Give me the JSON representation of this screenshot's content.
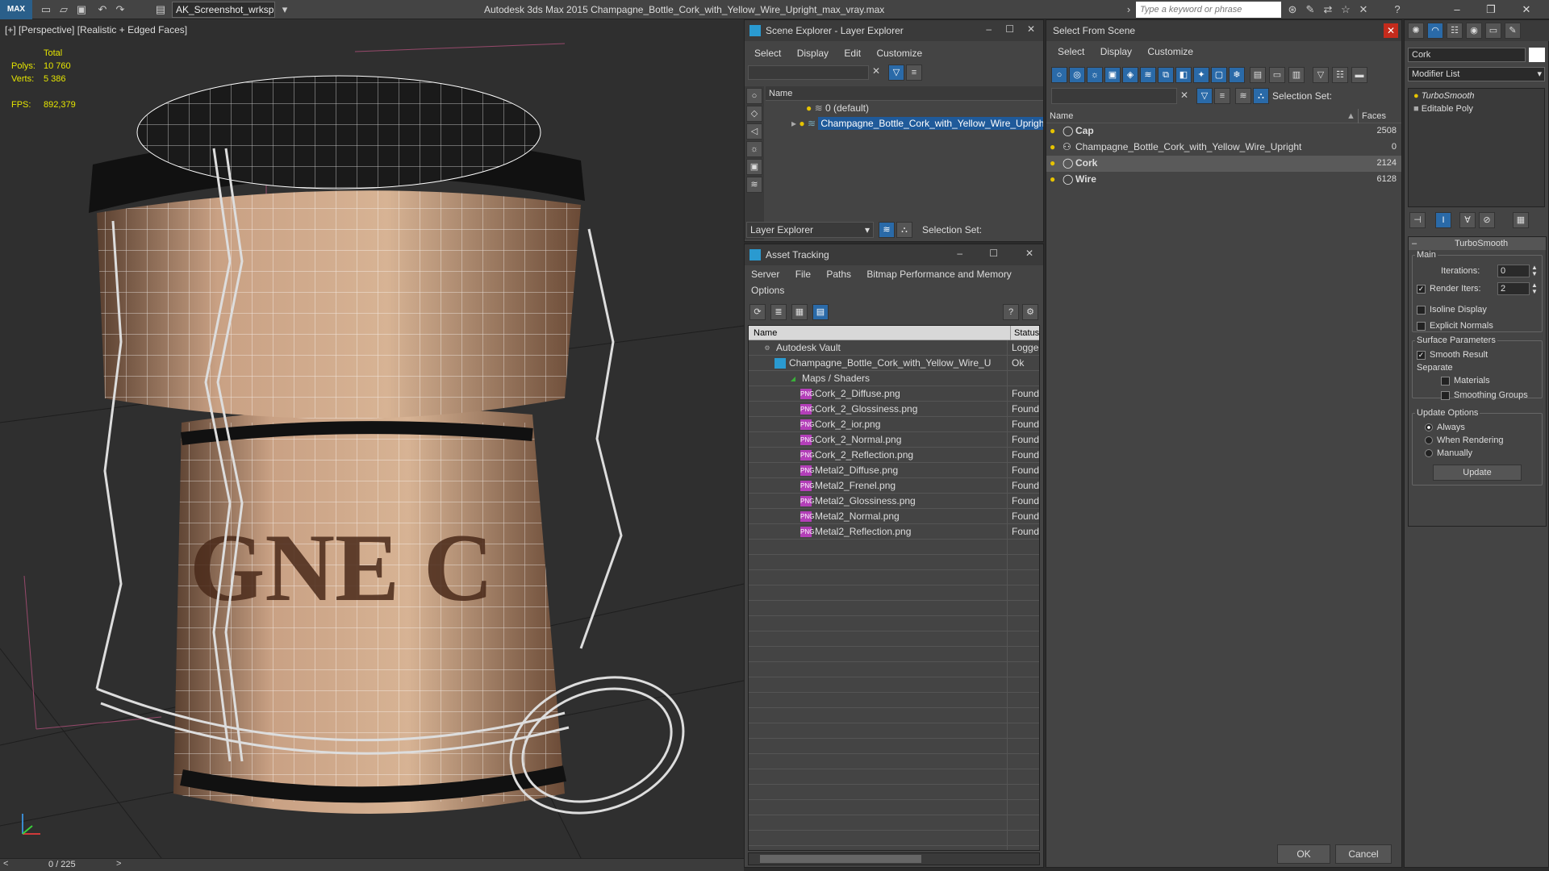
{
  "app": {
    "title": "Autodesk 3ds Max  2015    Champagne_Bottle_Cork_with_Yellow_Wire_Upright_max_vray.max",
    "workspace": "AK_Screenshot_wrksp",
    "search_placeholder": "Type a keyword or phrase"
  },
  "viewport": {
    "label": "[+] [Perspective] [Realistic + Edged Faces]",
    "stats": {
      "total_label": "Total",
      "polys_label": "Polys:",
      "polys_value": "10 760",
      "verts_label": "Verts:",
      "verts_value": "5 386",
      "fps_label": "FPS:",
      "fps_value": "892,379"
    },
    "texture_text": "GNE C",
    "timeline": "0 / 225"
  },
  "scene_explorer": {
    "title": "Scene Explorer - Layer Explorer",
    "menu": [
      "Select",
      "Display",
      "Edit",
      "Customize"
    ],
    "name_header": "Name",
    "rows": [
      "0 (default)",
      "Champagne_Bottle_Cork_with_Yellow_Wire_Upright"
    ],
    "footer_dropdown": "Layer Explorer",
    "selection_set_label": "Selection Set:"
  },
  "asset_tracking": {
    "title": "Asset Tracking",
    "menu": [
      "Server",
      "File",
      "Paths",
      "Bitmap Performance and Memory"
    ],
    "menu2": "Options",
    "headers": {
      "name": "Name",
      "status": "Status"
    },
    "rows": [
      {
        "name": "Autodesk Vault",
        "status": "Logged",
        "indent": 0
      },
      {
        "name": "Champagne_Bottle_Cork_with_Yellow_Wire_Upri...",
        "status": "Ok",
        "indent": 1
      },
      {
        "name": "Maps / Shaders",
        "status": "",
        "indent": 2
      },
      {
        "name": "Cork_2_Diffuse.png",
        "status": "Found",
        "indent": 3
      },
      {
        "name": "Cork_2_Glossiness.png",
        "status": "Found",
        "indent": 3
      },
      {
        "name": "Cork_2_ior.png",
        "status": "Found",
        "indent": 3
      },
      {
        "name": "Cork_2_Normal.png",
        "status": "Found",
        "indent": 3
      },
      {
        "name": "Cork_2_Reflection.png",
        "status": "Found",
        "indent": 3
      },
      {
        "name": "Metal2_Diffuse.png",
        "status": "Found",
        "indent": 3
      },
      {
        "name": "Metal2_Frenel.png",
        "status": "Found",
        "indent": 3
      },
      {
        "name": "Metal2_Glossiness.png",
        "status": "Found",
        "indent": 3
      },
      {
        "name": "Metal2_Normal.png",
        "status": "Found",
        "indent": 3
      },
      {
        "name": "Metal2_Reflection.png",
        "status": "Found",
        "indent": 3
      }
    ]
  },
  "select_from_scene": {
    "title": "Select From Scene",
    "menu": [
      "Select",
      "Display",
      "Customize"
    ],
    "selection_set_label": "Selection Set:",
    "headers": {
      "name": "Name",
      "faces": "Faces"
    },
    "rows": [
      {
        "name": "Cap",
        "faces": "2508",
        "bold": true,
        "selected": false
      },
      {
        "name": "Champagne_Bottle_Cork_with_Yellow_Wire_Upright",
        "faces": "0",
        "bold": false,
        "selected": false
      },
      {
        "name": "Cork",
        "faces": "2124",
        "bold": true,
        "selected": true
      },
      {
        "name": "Wire",
        "faces": "6128",
        "bold": true,
        "selected": false
      }
    ],
    "ok_label": "OK",
    "cancel_label": "Cancel"
  },
  "command_panel": {
    "object_name": "Cork",
    "modifier_list": "Modifier List",
    "stack": [
      "TurboSmooth",
      "Editable Poly"
    ],
    "rollout_title": "TurboSmooth",
    "main_label": "Main",
    "iterations_label": "Iterations:",
    "iterations_value": "0",
    "render_iters_label": "Render Iters:",
    "render_iters_value": "2",
    "isoline_label": "Isoline Display",
    "explicit_normals_label": "Explicit Normals",
    "surface_params_label": "Surface Parameters",
    "smooth_result_label": "Smooth Result",
    "separate_label": "Separate",
    "materials_label": "Materials",
    "smoothing_groups_label": "Smoothing Groups",
    "update_options_label": "Update Options",
    "always_label": "Always",
    "when_rendering_label": "When Rendering",
    "manually_label": "Manually",
    "update_button": "Update"
  },
  "colors": {
    "accent": "#2a6aa8",
    "selection": "#1f5a9a",
    "found_text": "#dddddd"
  }
}
